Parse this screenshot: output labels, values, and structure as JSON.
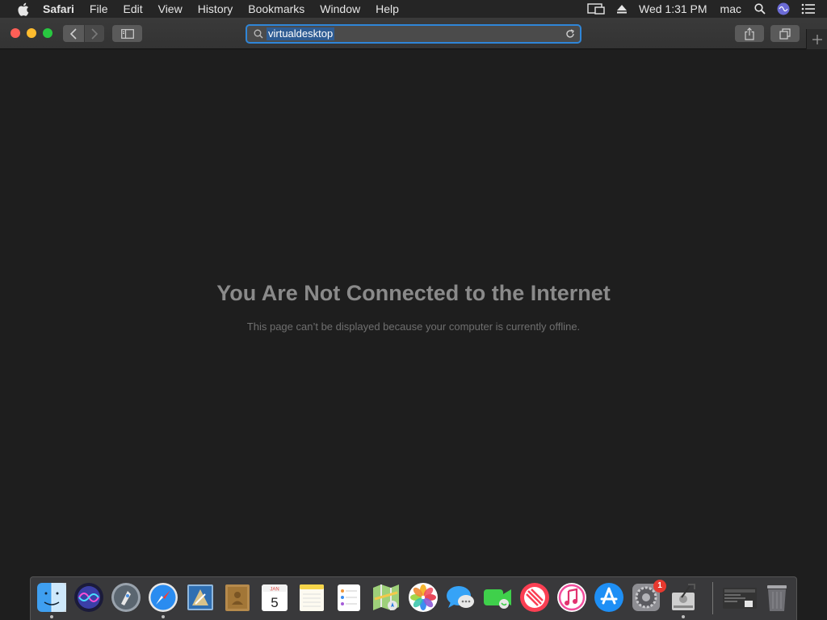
{
  "menubar": {
    "app_name": "Safari",
    "items": [
      "File",
      "Edit",
      "View",
      "History",
      "Bookmarks",
      "Window",
      "Help"
    ],
    "clock": "Wed 1:31 PM",
    "user": "mac"
  },
  "toolbar": {
    "url": "virtualdesktop"
  },
  "page": {
    "title": "You Are Not Connected to the Internet",
    "message": "This page can’t be displayed because your computer is currently offline."
  },
  "dock": {
    "apps": [
      "finder",
      "siri",
      "launchpad",
      "safari",
      "mail",
      "contacts",
      "calendar",
      "notes",
      "reminders",
      "maps",
      "photos",
      "messages",
      "facetime",
      "news",
      "itunes",
      "app-store",
      "system-preferences",
      "disk-utility",
      "screenshot",
      "trash"
    ],
    "calendar_month": "JAN",
    "calendar_day": "5",
    "system_preferences_badge": "1"
  },
  "colors": {
    "menubar": "#252525",
    "toolbar": "#363636",
    "content_bg": "#1e1e1e",
    "url_focus": "#2f86d8",
    "close": "#fe5f57",
    "minimize": "#febc2e",
    "maximize": "#28c840"
  }
}
